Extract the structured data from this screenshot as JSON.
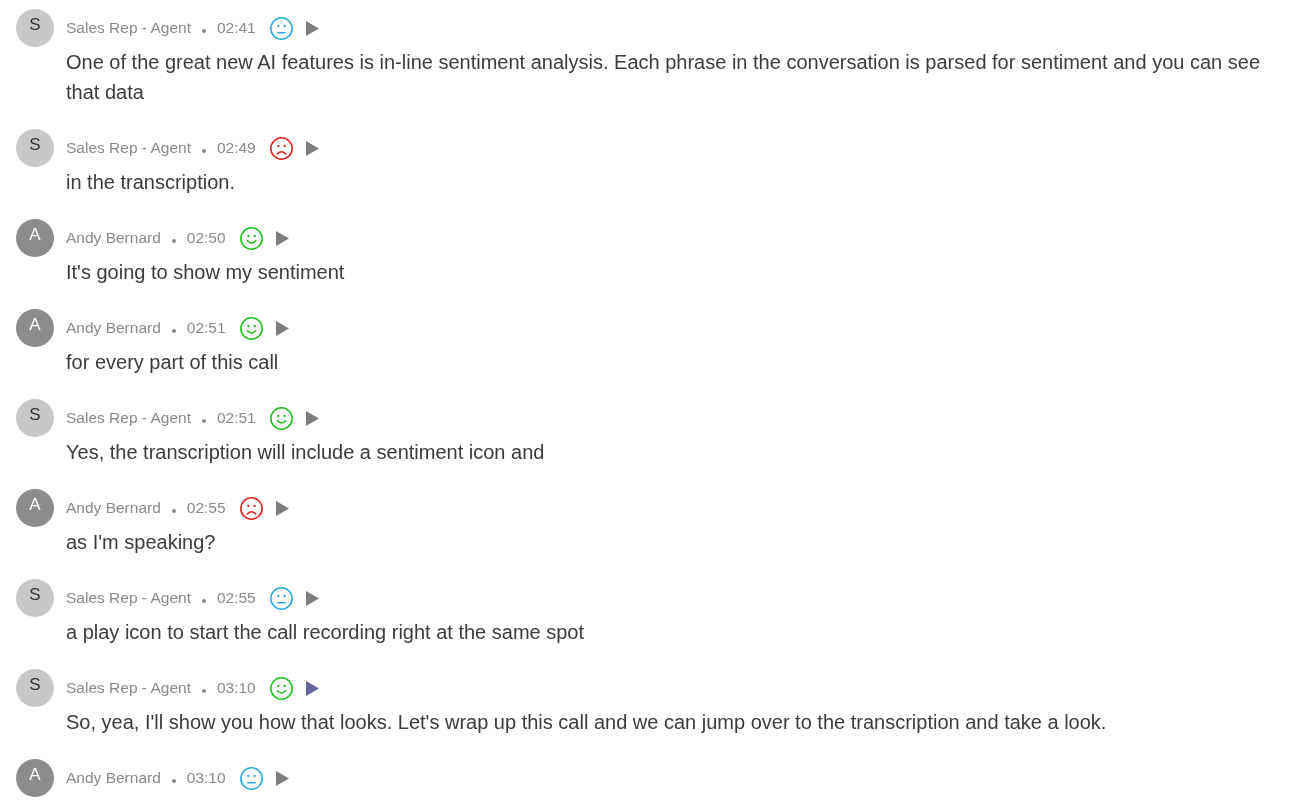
{
  "transcript": [
    {
      "kind": "agent",
      "avatar": "S",
      "speaker": "Sales Rep - Agent",
      "time": "02:41",
      "sentiment": {
        "kind": "neutral"
      },
      "play_highlighted": false,
      "message": "One of the great new AI features is in-line sentiment analysis. Each phrase in the conversation is parsed for sentiment and you can see that data"
    },
    {
      "kind": "agent",
      "avatar": "S",
      "speaker": "Sales Rep - Agent",
      "time": "02:49",
      "sentiment": {
        "kind": "negative"
      },
      "play_highlighted": false,
      "message": "in the transcription."
    },
    {
      "kind": "customer",
      "avatar": "A",
      "speaker": "Andy Bernard",
      "time": "02:50",
      "sentiment": {
        "kind": "positive"
      },
      "play_highlighted": false,
      "message": "It's going to show my sentiment"
    },
    {
      "kind": "customer",
      "avatar": "A",
      "speaker": "Andy Bernard",
      "time": "02:51",
      "sentiment": {
        "kind": "positive"
      },
      "play_highlighted": false,
      "message": "for every part of this call"
    },
    {
      "kind": "agent",
      "avatar": "S",
      "speaker": "Sales Rep - Agent",
      "time": "02:51",
      "sentiment": {
        "kind": "positive"
      },
      "play_highlighted": false,
      "message": "Yes, the transcription will include a sentiment icon and"
    },
    {
      "kind": "customer",
      "avatar": "A",
      "speaker": "Andy Bernard",
      "time": "02:55",
      "sentiment": {
        "kind": "negative"
      },
      "play_highlighted": false,
      "message": "as I'm speaking?"
    },
    {
      "kind": "agent",
      "avatar": "S",
      "speaker": "Sales Rep - Agent",
      "time": "02:55",
      "sentiment": {
        "kind": "neutral"
      },
      "play_highlighted": false,
      "message": "a play icon to start the call recording right at the same spot"
    },
    {
      "kind": "agent",
      "avatar": "S",
      "speaker": "Sales Rep - Agent",
      "time": "03:10",
      "sentiment": {
        "kind": "positive"
      },
      "play_highlighted": true,
      "message": "So, yea, I'll show you how that looks. Let's wrap up this call and we can jump over to the transcription and take a look."
    },
    {
      "kind": "customer",
      "avatar": "A",
      "speaker": "Andy Bernard",
      "time": "03:10",
      "sentiment": {
        "kind": "neutral"
      },
      "play_highlighted": false
    }
  ]
}
